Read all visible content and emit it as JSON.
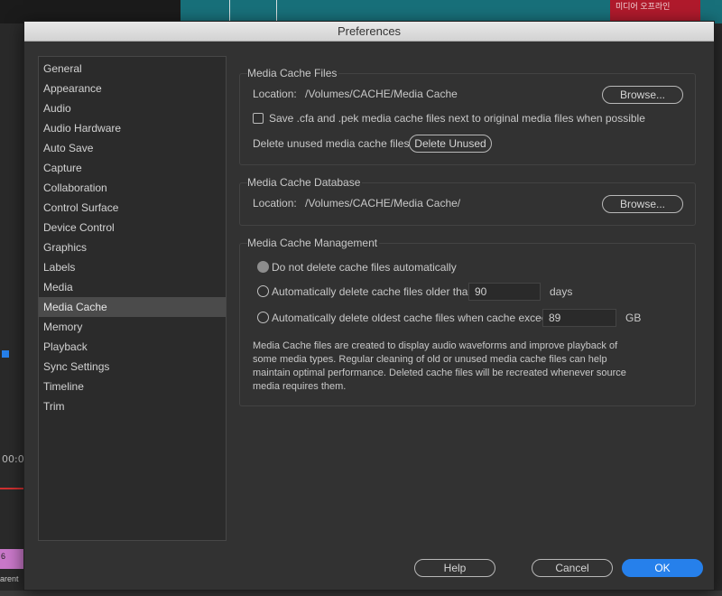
{
  "background": {
    "timecode": "00:0",
    "pink_clip_label": "6",
    "parent_label": "arent",
    "video_overlay_text": "미디어 오프라인"
  },
  "dialog": {
    "title": "Preferences"
  },
  "sidebar": {
    "items": [
      {
        "label": "General"
      },
      {
        "label": "Appearance"
      },
      {
        "label": "Audio"
      },
      {
        "label": "Audio Hardware"
      },
      {
        "label": "Auto Save"
      },
      {
        "label": "Capture"
      },
      {
        "label": "Collaboration"
      },
      {
        "label": "Control Surface"
      },
      {
        "label": "Device Control"
      },
      {
        "label": "Graphics"
      },
      {
        "label": "Labels"
      },
      {
        "label": "Media"
      },
      {
        "label": "Media Cache",
        "selected": true
      },
      {
        "label": "Memory"
      },
      {
        "label": "Playback"
      },
      {
        "label": "Sync Settings"
      },
      {
        "label": "Timeline"
      },
      {
        "label": "Trim"
      }
    ]
  },
  "cache_files": {
    "title": "Media Cache Files",
    "location_label": "Location:",
    "location_value": "/Volumes/CACHE/Media Cache",
    "browse_label": "Browse...",
    "save_next_label": "Save .cfa and .pek media cache files next to original media files when possible",
    "save_next_checked": false,
    "delete_unused_label": "Delete unused media cache files",
    "delete_unused_button": "Delete Unused"
  },
  "cache_db": {
    "title": "Media Cache Database",
    "location_label": "Location:",
    "location_value": "/Volumes/CACHE/Media Cache/",
    "browse_label": "Browse..."
  },
  "cache_mgmt": {
    "title": "Media Cache Management",
    "option_none": "Do not delete cache files automatically",
    "option_older": "Automatically delete cache files older than:",
    "older_value": "90",
    "older_unit": "days",
    "option_exceeds": "Automatically delete oldest cache files when cache exceeds:",
    "exceeds_value": "89",
    "exceeds_unit": "GB",
    "selected_option": "none",
    "description": "Media Cache files are created to display audio waveforms and improve playback of some media types.  Regular cleaning of old or unused media cache files can help maintain optimal performance. Deleted cache files will be recreated whenever source media requires them."
  },
  "footer": {
    "help_label": "Help",
    "cancel_label": "Cancel",
    "ok_label": "OK"
  },
  "colors": {
    "ok_button": "#2680eb",
    "dialog_bg": "#323232",
    "selected_item_bg": "#4b4b4b"
  }
}
